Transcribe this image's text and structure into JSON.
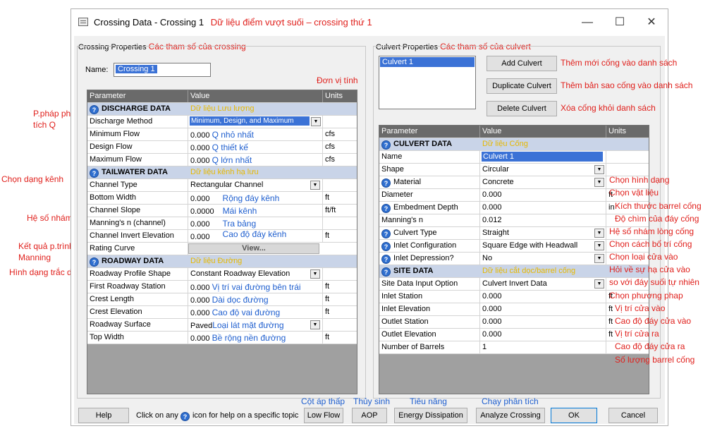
{
  "window": {
    "title": "Crossing Data - Crossing 1",
    "title_note": "Dữ liệu điểm vượt suối – crossing thứ 1",
    "minimize": "—",
    "maximize": "☐",
    "close": "✕"
  },
  "crossing": {
    "label": "Crossing Properties",
    "label_note": "Các tham số của crossing",
    "name_label": "Name:",
    "name_value": "Crossing 1",
    "units_note": "Đơn vị tính",
    "headers": [
      "Parameter",
      "Value",
      "Units"
    ],
    "discharge": {
      "title": "DISCHARGE DATA",
      "note": "Dữ liệu Lưu lượng",
      "method_label": "Discharge Method",
      "method_value": "Minimum, Design, and Maximum",
      "rows": [
        {
          "label": "Minimum Flow",
          "value": "0.000",
          "unit": "cfs",
          "note": "Q nhỏ nhất"
        },
        {
          "label": "Design Flow",
          "value": "0.000",
          "unit": "cfs",
          "note": "Q thiết kế"
        },
        {
          "label": "Maximum Flow",
          "value": "0.000",
          "unit": "cfs",
          "note": "Q lớn nhất"
        }
      ]
    },
    "tailwater": {
      "title": "TAILWATER DATA",
      "note": "Dữ liệu kênh hạ lưu",
      "channel_label": "Channel Type",
      "channel_value": "Rectangular Channel",
      "rows": [
        {
          "label": "Bottom Width",
          "value": "0.000",
          "unit": "ft",
          "note": "Rộng đáy kênh"
        },
        {
          "label": "Channel Slope",
          "value": "0.0000",
          "unit": "ft/ft",
          "note": "Mái kênh"
        },
        {
          "label": "Manning's n (channel)",
          "value": "0.000",
          "unit": "",
          "note": "Tra bảng"
        },
        {
          "label": "Channel Invert Elevation",
          "value": "0.000",
          "unit": "ft",
          "note": "Cao độ đáy kênh"
        }
      ],
      "rating_label": "Rating Curve",
      "rating_button": "View..."
    },
    "roadway": {
      "title": "ROADWAY DATA",
      "note": "Dữ liệu Đường",
      "profile_label": "Roadway Profile Shape",
      "profile_value": "Constant Roadway Elevation",
      "rows": [
        {
          "label": "First Roadway Station",
          "value": "0.000",
          "unit": "ft",
          "note": "Vị trí vai đường bên trái"
        },
        {
          "label": "Crest Length",
          "value": "0.000",
          "unit": "ft",
          "note": "Dài dọc đường"
        },
        {
          "label": "Crest Elevation",
          "value": "0.000",
          "unit": "ft",
          "note": "Cao độ vai đường"
        }
      ],
      "surface_label": "Roadway Surface",
      "surface_value": "Paved",
      "surface_note": "Loại lát mặt đường",
      "top_label": "Top Width",
      "top_value": "0.000",
      "top_unit": "ft",
      "top_note": "Bề rộng nền đường"
    }
  },
  "left_notes": {
    "q_method_1": "P.pháp phân",
    "q_method_2": "tích Q",
    "channel": "Chọn dạng kênh",
    "roughness": "Hệ số nhám",
    "manning_1": "Kết quả p.trình",
    "manning_2": "Manning",
    "profile": "Hình dạng trắc dọc"
  },
  "culvert": {
    "label": "Culvert Properties",
    "label_note": "Các tham số của culvert",
    "list": [
      "Culvert 1"
    ],
    "add_button": "Add Culvert",
    "add_note": "Thêm mới cống vào danh sách",
    "duplicate_button": "Duplicate Culvert",
    "duplicate_note": "Thêm bản sao cống vào danh sách",
    "delete_button": "Delete Culvert",
    "delete_note": "Xóa cống khỏi danh sách",
    "headers": [
      "Parameter",
      "Value",
      "Units"
    ],
    "culvert_data_title": "CULVERT DATA",
    "culvert_data_note": "Dữ liệu Cống",
    "name_label": "Name",
    "name_value": "Culvert 1",
    "shape_label": "Shape",
    "shape_value": "Circular",
    "shape_note": "Chọn hình dạng",
    "material_label": "Material",
    "material_value": "Concrete",
    "material_note": "Chọn vật liệu",
    "diameter_label": "Diameter",
    "diameter_value": "0.000",
    "diameter_unit": "ft",
    "diameter_note": "Kích thước barrel cống",
    "embed_label": "Embedment Depth",
    "embed_value": "0.000",
    "embed_unit": "in",
    "embed_note": "Độ chìm của đáy cống",
    "manning_label": "Manning's n",
    "manning_value": "0.012",
    "manning_note": "Hệ số nhám lòng cống",
    "type_label": "Culvert Type",
    "type_value": "Straight",
    "type_note": "Chọn cách bố trí cống",
    "inlet_cfg_label": "Inlet Configuration",
    "inlet_cfg_value": "Square Edge with Headwall",
    "inlet_cfg_note": "Chọn loại cửa vào",
    "inlet_dep_label": "Inlet Depression?",
    "inlet_dep_value": "No",
    "inlet_dep_note_1": "Hỏi về sự hạ cửa vào",
    "inlet_dep_note_2": "so với đáy suối tự nhiên",
    "site_title": "SITE DATA",
    "site_note": "Dữ liệu cắt dọc/barrel cống",
    "site_opt_label": "Site Data Input Option",
    "site_opt_value": "Culvert Invert Data",
    "site_opt_note": "Chọn phương phap",
    "site_rows": [
      {
        "label": "Inlet Station",
        "value": "0.000",
        "unit": "ft",
        "note": "Vị trí cửa vào"
      },
      {
        "label": "Inlet Elevation",
        "value": "0.000",
        "unit": "ft",
        "note": "Cao độ đáy  cửa vào"
      },
      {
        "label": "Outlet Station",
        "value": "0.000",
        "unit": "ft",
        "note": "Vị trí cửa ra"
      },
      {
        "label": "Outlet Elevation",
        "value": "0.000",
        "unit": "ft",
        "note": "Cao độ đáy cửa ra"
      }
    ],
    "barrels_label": "Number of Barrels",
    "barrels_value": "1",
    "barrels_note": "Số lượng barrel cống"
  },
  "footer": {
    "help": "Help",
    "hint_pre": "Click on any",
    "hint_post": "icon for help on a specific topic",
    "low_flow": "Low Flow",
    "low_flow_note": "Cột áp thấp",
    "aop": "AOP",
    "aop_note": "Thủy sinh",
    "energy": "Energy Dissipation",
    "energy_note": "Tiêu năng",
    "analyze": "Analyze Crossing",
    "analyze_note": "Chạy phân tích",
    "ok": "OK",
    "cancel": "Cancel"
  }
}
